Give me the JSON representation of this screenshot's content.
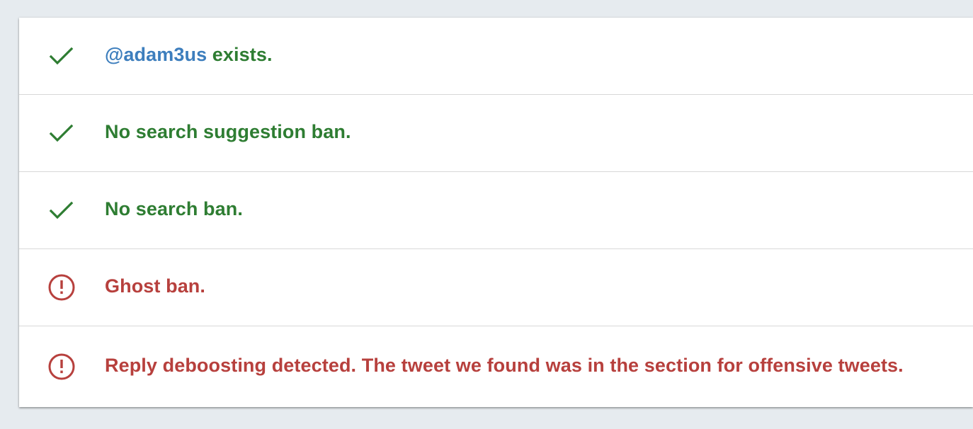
{
  "colors": {
    "ok": "#2e7d32",
    "bad": "#b7403d",
    "handle": "#3d7ebd",
    "background": "#e6ebef"
  },
  "results": [
    {
      "status": "ok",
      "icon": "check-icon",
      "handle": "@adam3us",
      "text": " exists."
    },
    {
      "status": "ok",
      "icon": "check-icon",
      "text": "No search suggestion ban."
    },
    {
      "status": "ok",
      "icon": "check-icon",
      "text": "No search ban."
    },
    {
      "status": "bad",
      "icon": "alert-circle-icon",
      "text": "Ghost ban."
    },
    {
      "status": "bad",
      "icon": "alert-circle-icon",
      "text": "Reply deboosting detected. The tweet we found was in the section for offensive tweets."
    }
  ]
}
